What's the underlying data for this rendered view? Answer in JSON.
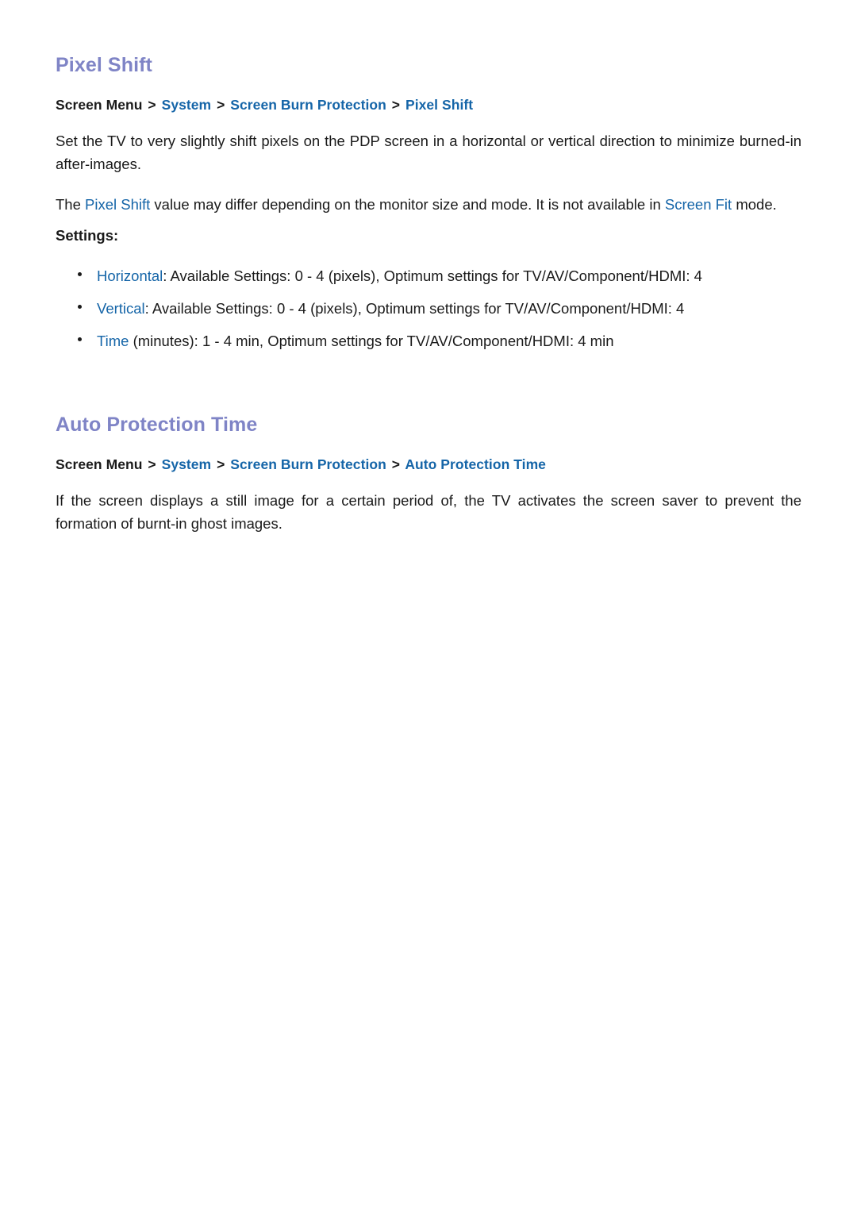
{
  "document": {
    "sections": [
      {
        "heading": "Pixel Shift",
        "breadcrumb": {
          "root": "Screen Menu",
          "separator": ">",
          "links": [
            "System",
            "Screen Burn Protection",
            "Pixel Shift"
          ]
        },
        "paragraphs": [
          {
            "runs": [
              {
                "text": "Set the TV to very slightly shift pixels on the PDP screen in a horizontal or vertical direction to minimize burned-in after-images.",
                "style": "plain"
              }
            ]
          },
          {
            "runs": [
              {
                "text": "The ",
                "style": "plain"
              },
              {
                "text": "Pixel Shift",
                "style": "blue"
              },
              {
                "text": " value may differ depending on the monitor size and mode. It is not available in ",
                "style": "plain"
              },
              {
                "text": "Screen Fit",
                "style": "blue"
              },
              {
                "text": " mode.",
                "style": "plain"
              }
            ]
          }
        ],
        "settings_label": "Settings:",
        "bullets": [
          {
            "label": "Horizontal",
            "label_suffix": ":",
            "text": " Available Settings: 0 - 4 (pixels), Optimum settings for TV/AV/Component/HDMI: 4"
          },
          {
            "label": "Vertical",
            "label_suffix": ":",
            "text": " Available Settings: 0 - 4 (pixels), Optimum settings for TV/AV/Component/HDMI: 4"
          },
          {
            "label": "Time",
            "label_suffix": " (minutes):",
            "text": " 1 - 4 min, Optimum settings for TV/AV/Component/HDMI: 4 min"
          }
        ]
      },
      {
        "heading": "Auto Protection Time",
        "breadcrumb": {
          "root": "Screen Menu",
          "separator": ">",
          "links": [
            "System",
            "Screen Burn Protection",
            "Auto Protection Time"
          ]
        },
        "paragraphs": [
          {
            "runs": [
              {
                "text": "If the screen displays a still image for a certain period of, the TV activates the screen saver to prevent the formation of burnt-in ghost images.",
                "style": "plain"
              }
            ]
          }
        ],
        "settings_label": null,
        "bullets": []
      }
    ]
  },
  "colors": {
    "heading": "#7f84c6",
    "link": "#1565a8",
    "body_text": "#1a1a1a",
    "background": "#ffffff"
  }
}
